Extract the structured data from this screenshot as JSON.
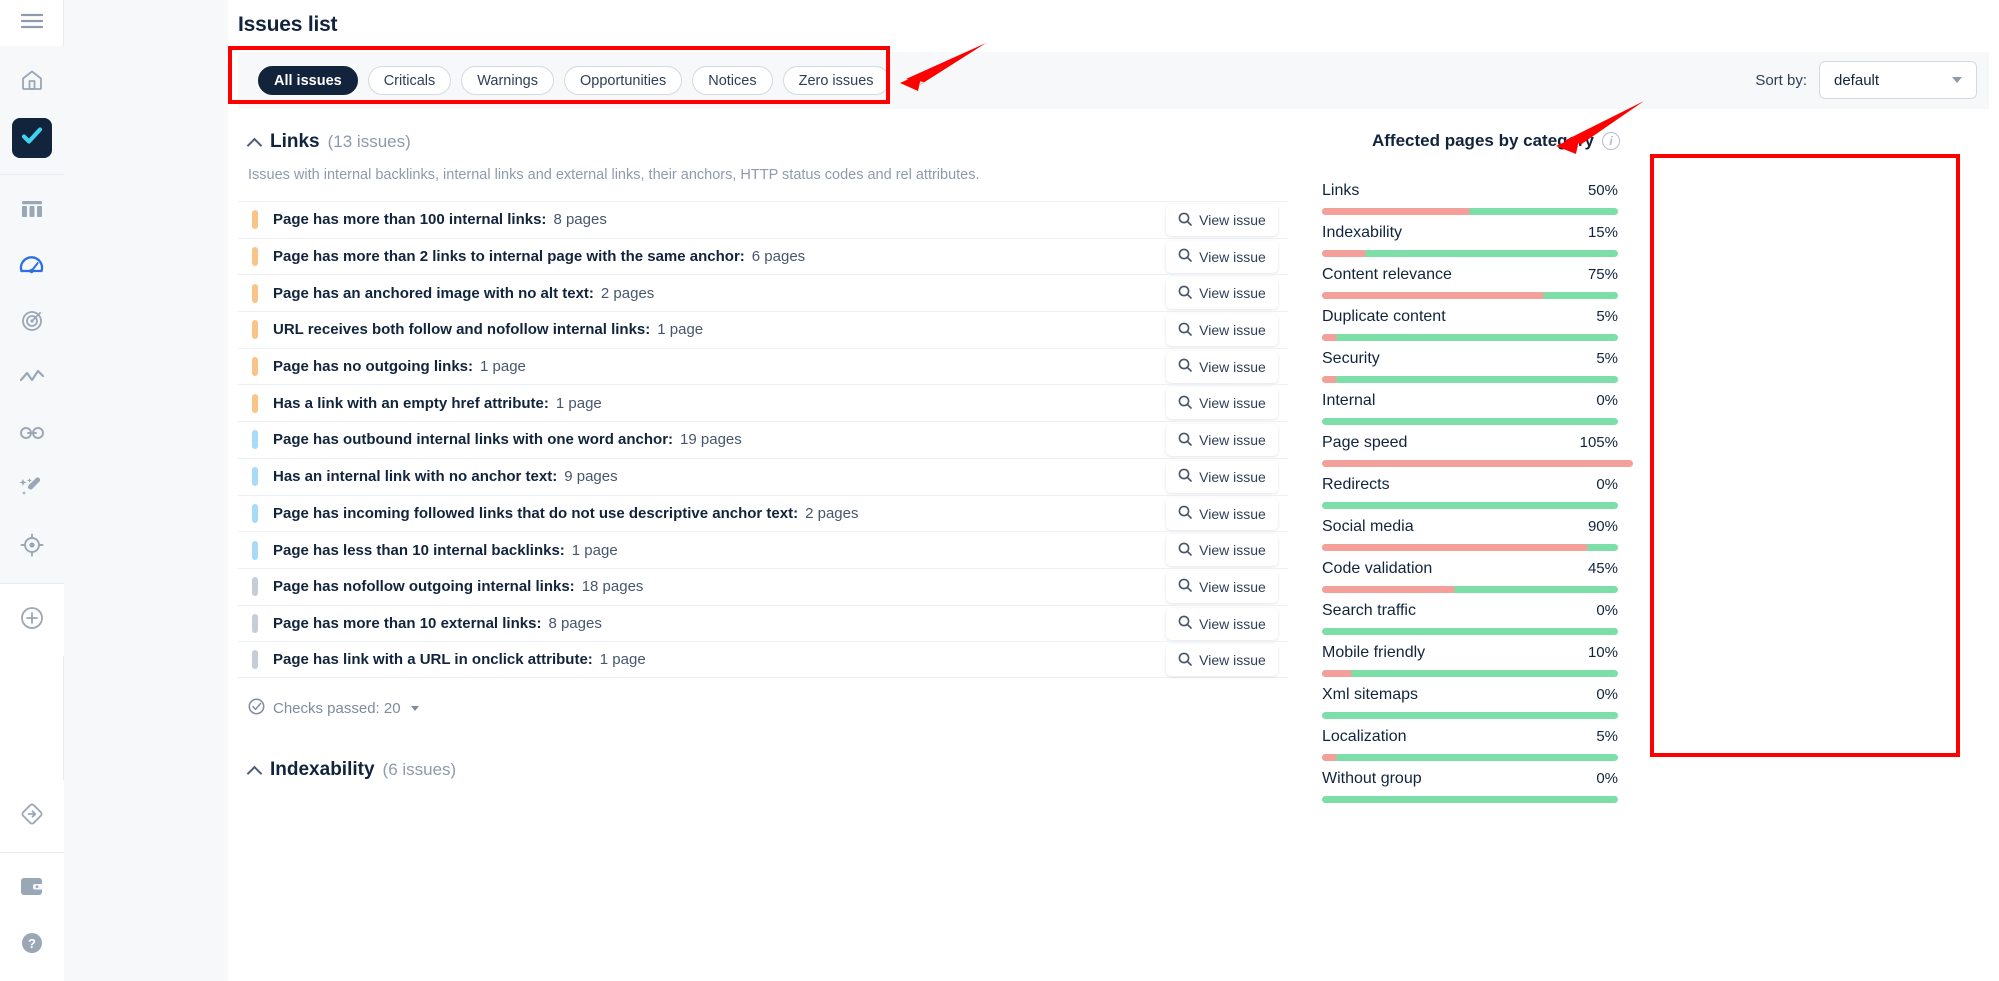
{
  "rail": {
    "items": [
      {
        "name": "menu-icon",
        "state": "plain"
      },
      {
        "name": "home-icon",
        "state": "plain"
      },
      {
        "name": "site-audit-checkmark-icon",
        "state": "active-dark"
      },
      {
        "name": "dashboard-grid-icon",
        "state": "plain"
      },
      {
        "name": "speedometer-icon",
        "state": "active-blue"
      },
      {
        "name": "radar-target-icon",
        "state": "plain"
      },
      {
        "name": "trend-line-icon",
        "state": "plain"
      },
      {
        "name": "link-chain-icon",
        "state": "plain"
      },
      {
        "name": "magic-wand-icon",
        "state": "plain"
      },
      {
        "name": "crosshair-icon",
        "state": "plain"
      },
      {
        "name": "plus-circle-icon",
        "state": "plain"
      },
      {
        "name": "redirect-diamond-icon",
        "state": "plain"
      },
      {
        "name": "wallet-icon",
        "state": "plain"
      },
      {
        "name": "help-question-icon",
        "state": "plain"
      }
    ]
  },
  "header": {
    "title": "Issues list"
  },
  "filters": {
    "chips": [
      {
        "label": "All issues",
        "selected": true
      },
      {
        "label": "Criticals",
        "selected": false
      },
      {
        "label": "Warnings",
        "selected": false
      },
      {
        "label": "Opportunities",
        "selected": false
      },
      {
        "label": "Notices",
        "selected": false
      },
      {
        "label": "Zero issues",
        "selected": false
      }
    ]
  },
  "sort": {
    "label": "Sort by:",
    "value": "default",
    "options": [
      "default"
    ]
  },
  "sections": [
    {
      "title": "Links",
      "count_label": "(13 issues)",
      "description": "Issues with internal backlinks, internal links and external links, their anchors, HTTP status codes and rel attributes.",
      "checks_passed_label": "Checks passed: 20",
      "view_button_label": "View issue",
      "issues": [
        {
          "severity": "warn",
          "label": "Page has more than 100 internal links:",
          "count": "8 pages"
        },
        {
          "severity": "warn",
          "label": "Page has more than 2 links to internal page with the same anchor:",
          "count": "6 pages"
        },
        {
          "severity": "warn",
          "label": "Page has an anchored image with no alt text:",
          "count": "2 pages"
        },
        {
          "severity": "warn",
          "label": "URL receives both follow and nofollow internal links:",
          "count": "1 page"
        },
        {
          "severity": "warn",
          "label": "Page has no outgoing links:",
          "count": "1 page"
        },
        {
          "severity": "warn",
          "label": "Has a link with an empty href attribute:",
          "count": "1 page"
        },
        {
          "severity": "note",
          "label": "Page has outbound internal links with one word anchor:",
          "count": "19 pages"
        },
        {
          "severity": "note",
          "label": "Has an internal link with no anchor text:",
          "count": "9 pages"
        },
        {
          "severity": "note",
          "label": "Page has incoming followed links that do not use descriptive anchor text:",
          "count": "2 pages"
        },
        {
          "severity": "note",
          "label": "Page has less than 10 internal backlinks:",
          "count": "1 page"
        },
        {
          "severity": "zero",
          "label": "Page has nofollow outgoing internal links:",
          "count": "18 pages"
        },
        {
          "severity": "zero",
          "label": "Page has more than 10 external links:",
          "count": "8 pages"
        },
        {
          "severity": "zero",
          "label": "Page has link with a URL in onclick attribute:",
          "count": "1 page"
        }
      ]
    }
  ],
  "next_section": {
    "title": "Indexability",
    "count_label": "(6 issues)"
  },
  "affected": {
    "title": "Affected pages by category",
    "info_icon": "info-icon",
    "categories": [
      {
        "name": "Links",
        "percent": "50%",
        "value": 50
      },
      {
        "name": "Indexability",
        "percent": "15%",
        "value": 15
      },
      {
        "name": "Content relevance",
        "percent": "75%",
        "value": 75
      },
      {
        "name": "Duplicate content",
        "percent": "5%",
        "value": 5
      },
      {
        "name": "Security",
        "percent": "5%",
        "value": 5
      },
      {
        "name": "Internal",
        "percent": "0%",
        "value": 0
      },
      {
        "name": "Page speed",
        "percent": "105%",
        "value": 105
      },
      {
        "name": "Redirects",
        "percent": "0%",
        "value": 0
      },
      {
        "name": "Social media",
        "percent": "90%",
        "value": 90
      },
      {
        "name": "Code validation",
        "percent": "45%",
        "value": 45
      },
      {
        "name": "Search traffic",
        "percent": "0%",
        "value": 0
      },
      {
        "name": "Mobile friendly",
        "percent": "10%",
        "value": 10
      },
      {
        "name": "Xml sitemaps",
        "percent": "0%",
        "value": 0
      },
      {
        "name": "Localization",
        "percent": "5%",
        "value": 5
      },
      {
        "name": "Without group",
        "percent": "0%",
        "value": 0
      }
    ]
  },
  "colors": {
    "accent_dark": "#12243c",
    "annotation_red": "#ff0000",
    "bar_red": "#f4a09a",
    "bar_green": "#7ddfa7",
    "severity_warning": "#f9c489",
    "severity_notice": "#a8dbf7",
    "severity_zero": "#c7cdd6"
  }
}
